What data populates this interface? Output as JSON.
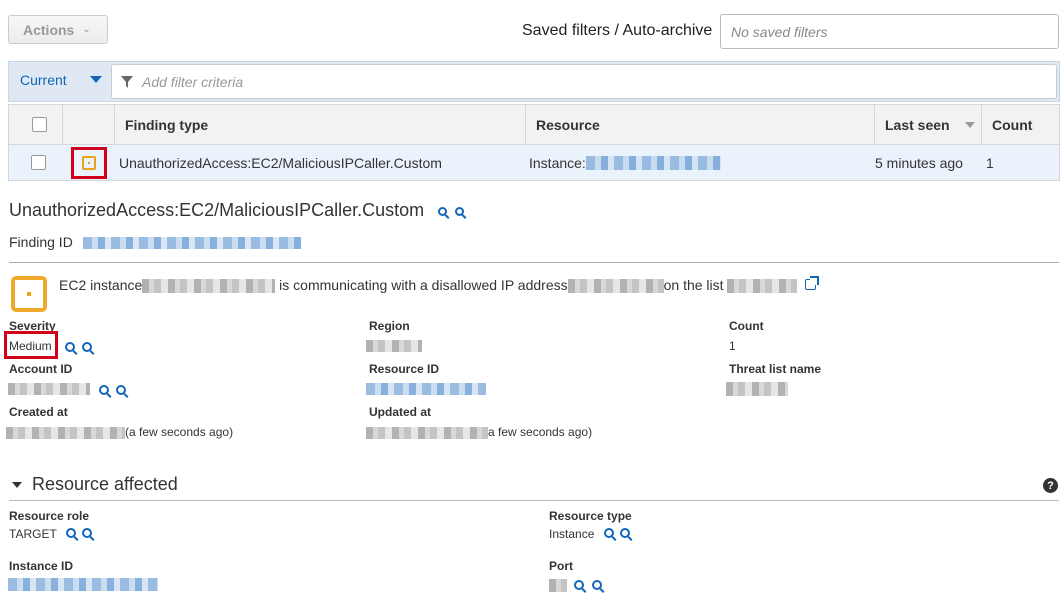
{
  "toolbar": {
    "actions_label": "Actions",
    "saved_filters_label": "Saved filters / Auto-archive",
    "saved_filters_placeholder": "No saved filters"
  },
  "filter": {
    "current_label": "Current",
    "placeholder": "Add filter criteria"
  },
  "table": {
    "columns": [
      "Finding type",
      "Resource",
      "Last seen",
      "Count"
    ],
    "rows": [
      {
        "finding_type": "UnauthorizedAccess:EC2/MaliciousIPCaller.Custom",
        "resource_prefix": "Instance:",
        "last_seen": "5 minutes ago",
        "count": "1"
      }
    ]
  },
  "detail": {
    "title": "UnauthorizedAccess:EC2/MaliciousIPCaller.Custom",
    "finding_id_label": "Finding ID",
    "summary": {
      "part1": "EC2 instance",
      "part2": "is communicating with a disallowed IP address",
      "part3": "on the list"
    },
    "fields": {
      "severity_label": "Severity",
      "severity_value": "Medium",
      "region_label": "Region",
      "count_label": "Count",
      "count_value": "1",
      "account_id_label": "Account ID",
      "resource_id_label": "Resource ID",
      "threat_list_label": "Threat list name",
      "created_at_label": "Created at",
      "created_at_suffix": "(a few seconds ago)",
      "updated_at_label": "Updated at",
      "updated_at_suffix": "a few seconds ago)"
    }
  },
  "resource_affected": {
    "heading": "Resource affected",
    "resource_role_label": "Resource role",
    "resource_role_value": "TARGET",
    "resource_type_label": "Resource type",
    "resource_type_value": "Instance",
    "instance_id_label": "Instance ID",
    "port_label": "Port"
  },
  "colors": {
    "accent": "#1166bb",
    "severity_medium": "#f0a92b",
    "highlight_outline": "#d0021b"
  }
}
